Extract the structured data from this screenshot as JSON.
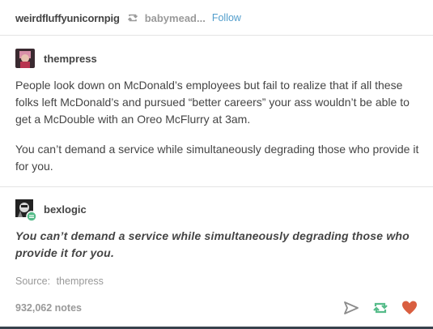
{
  "header": {
    "reblogger": "weirdfluffyunicornpig",
    "source": "babymead...",
    "follow_label": "Follow"
  },
  "post1": {
    "username": "thempress",
    "paragraph1": "People look down on McDonald’s employees but fail to realize that if all these folks left McDonald’s and pursued “better careers”  your ass wouldn’t be able to get a McDouble with an Oreo McFlurry at 3am.",
    "paragraph2": "You can’t demand a service while simultaneously degrading those who provide it for you."
  },
  "post2": {
    "username": "bexlogic",
    "text": "You can’t demand a service while simultaneously degrading those who provide it for you."
  },
  "source": {
    "label": "Source:",
    "name": "thempress"
  },
  "notes": "932,062 notes",
  "icons": {
    "reblog_header": "reblog-icon",
    "share": "share-icon",
    "reblog": "reblog-icon",
    "like": "heart-icon"
  },
  "colors": {
    "follow": "#529ecc",
    "reblog_green": "#56bc8a",
    "like_red": "#d95e40",
    "bottom_bar": "#37424d"
  }
}
